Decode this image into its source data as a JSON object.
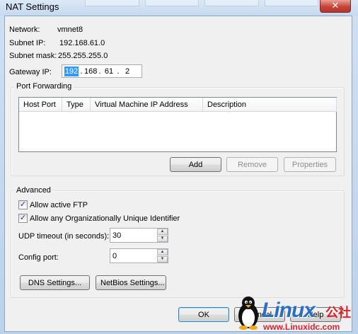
{
  "window": {
    "title": "NAT Settings",
    "close_glyph": "✕"
  },
  "network": {
    "network_label": "Network:",
    "network_value": "vmnet8",
    "subnet_ip_label": "Subnet IP:",
    "subnet_ip_value": "192.168.61.0",
    "subnet_mask_label": "Subnet mask:",
    "subnet_mask_value": "255.255.255.0",
    "gateway_label": "Gateway IP:",
    "gateway_octets": [
      "192",
      "168",
      "61",
      "2"
    ]
  },
  "port_forwarding": {
    "group_title": "Port Forwarding",
    "columns": [
      "Host Port",
      "Type",
      "Virtual Machine IP Address",
      "Description"
    ],
    "rows": [],
    "add_label": "Add",
    "remove_label": "Remove",
    "properties_label": "Properties"
  },
  "advanced": {
    "group_title": "Advanced",
    "allow_ftp_label": "Allow active FTP",
    "allow_ftp_checked": true,
    "allow_oui_label": "Allow any Organizationally Unique Identifier",
    "allow_oui_checked": true,
    "udp_timeout_label": "UDP timeout (in seconds):",
    "udp_timeout_value": "30",
    "config_port_label": "Config port:",
    "config_port_value": "0",
    "dns_label": "DNS Settings...",
    "netbios_label": "NetBios Settings..."
  },
  "footer": {
    "ok_label": "OK",
    "cancel_label": "Cancel",
    "help_label": "Help"
  },
  "watermark": {
    "logo": "Linux",
    "cn": "公社",
    "url": "www.Linuxidc.com"
  },
  "colors": {
    "selection": "#3399ff",
    "logo_blue": "#2a6fc2",
    "logo_red": "#d9232d"
  }
}
